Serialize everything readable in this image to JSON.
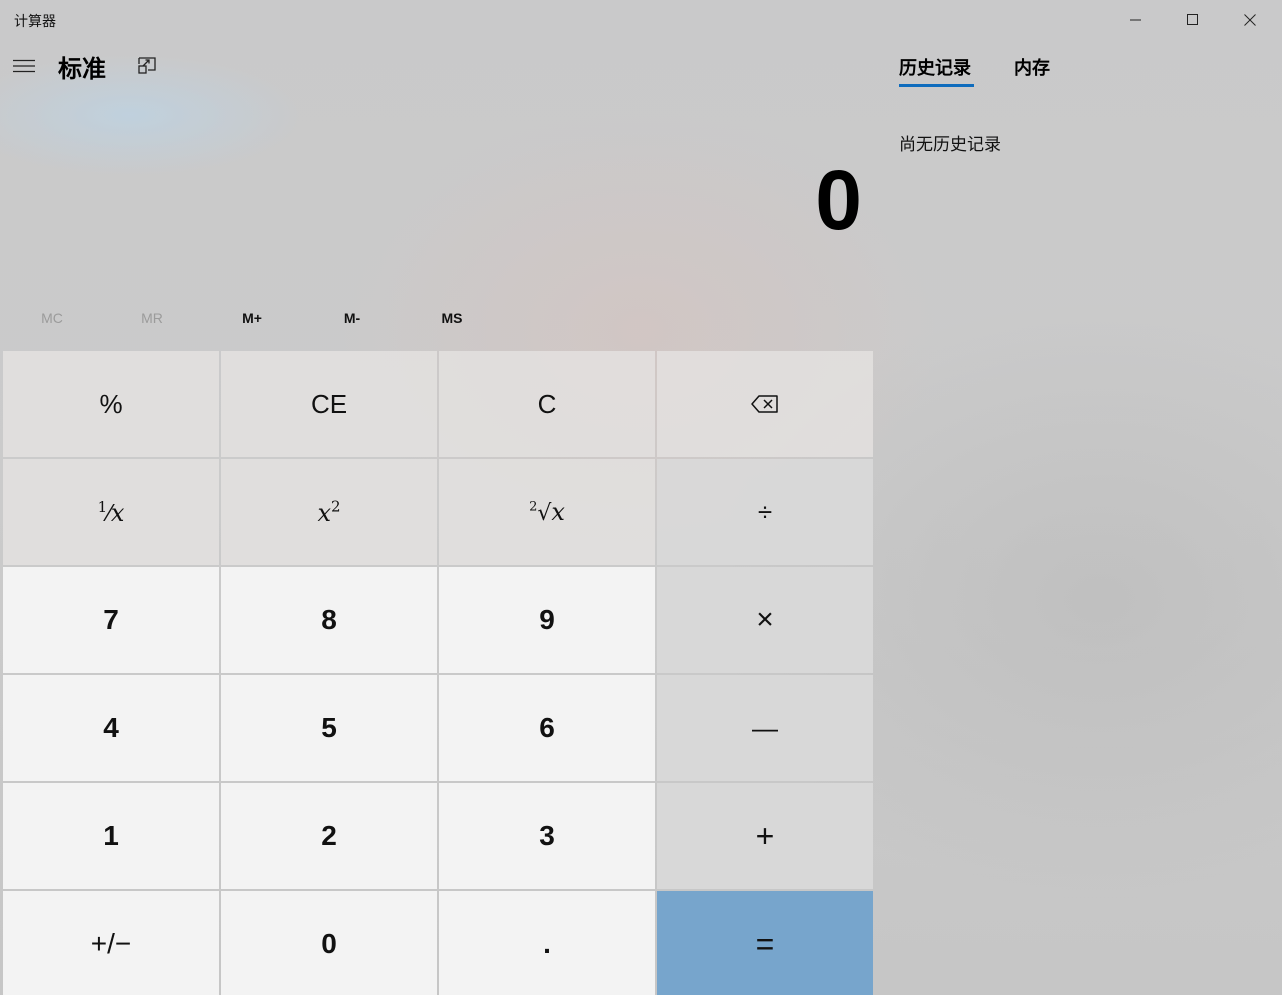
{
  "window": {
    "title": "计算器",
    "controls": [
      "minimize-icon",
      "maximize-icon",
      "close-icon"
    ]
  },
  "header": {
    "mode_title": "标准",
    "menu_icon": "hamburger-icon",
    "keep_on_top_icon": "keep-on-top-icon"
  },
  "display": {
    "value": "0"
  },
  "memory": {
    "buttons": [
      {
        "label": "MC",
        "enabled": false
      },
      {
        "label": "MR",
        "enabled": false
      },
      {
        "label": "M+",
        "enabled": true
      },
      {
        "label": "M-",
        "enabled": true
      },
      {
        "label": "MS",
        "enabled": true
      }
    ]
  },
  "keys": {
    "percent": "%",
    "ce": "CE",
    "c": "C",
    "backspace_icon": "backspace-icon",
    "reciprocal_num": "1",
    "reciprocal_x": "x",
    "square_x": "x",
    "square_exp": "2",
    "sqrt_index": "2",
    "sqrt_x": "x",
    "divide": "÷",
    "n7": "7",
    "n8": "8",
    "n9": "9",
    "multiply": "×",
    "n4": "4",
    "n5": "5",
    "n6": "6",
    "minus": "—",
    "n1": "1",
    "n2": "2",
    "n3": "3",
    "plus": "+",
    "negate": "+/−",
    "n0": "0",
    "decimal": ".",
    "equals": "="
  },
  "colors": {
    "equals_bg": "#77a5cc",
    "tab_underline": "#0f6cbd",
    "number_key_bg": "#f3f3f3"
  },
  "history_panel": {
    "tabs": [
      "历史记录",
      "内存"
    ],
    "active_tab": "历史记录",
    "empty_message": "尚无历史记录"
  }
}
